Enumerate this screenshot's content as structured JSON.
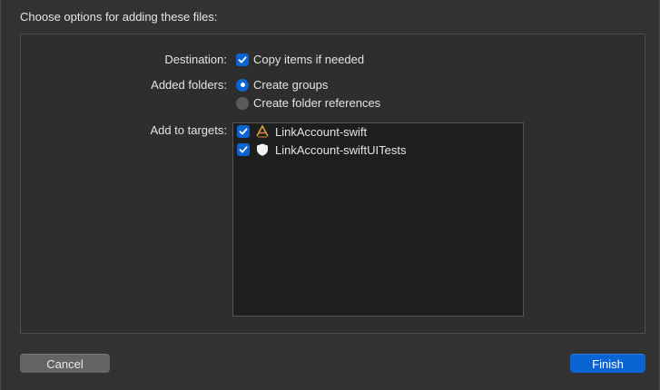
{
  "dialog": {
    "title": "Choose options for adding these files:"
  },
  "options": {
    "destination_label": "Destination:",
    "destination_option": "Copy items if needed",
    "destination_checked": true,
    "added_folders_label": "Added folders:",
    "folders_options": [
      {
        "label": "Create groups",
        "selected": true
      },
      {
        "label": "Create folder references",
        "selected": false
      }
    ],
    "targets_label": "Add to targets:",
    "targets": [
      {
        "label": "LinkAccount-swift",
        "checked": true,
        "icon": "app-target-icon"
      },
      {
        "label": "LinkAccount-swiftUITests",
        "checked": true,
        "icon": "test-target-icon"
      }
    ]
  },
  "buttons": {
    "cancel_label": "Cancel",
    "finish_label": "Finish"
  },
  "colors": {
    "accent": "#0a64d4",
    "background": "#323232",
    "list_background": "#1e1e1e"
  }
}
